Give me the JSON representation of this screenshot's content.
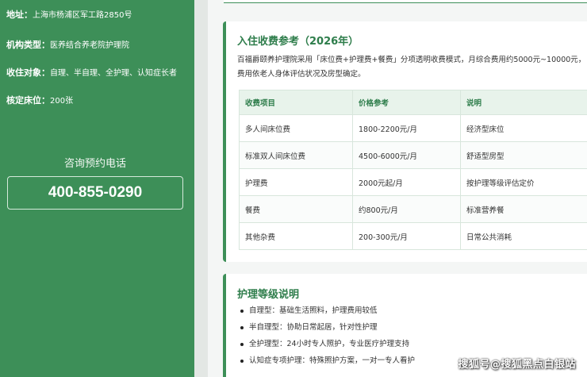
{
  "sidebar": {
    "address_label": "地址：",
    "address_value": "上海市杨浦区军工路2850号",
    "type_label": "机构类型：",
    "type_value": "医养结合养老院护理院",
    "target_label": "收住对象：",
    "target_value": "自理、半自理、全护理、认知症长者",
    "beds_label": "核定床位：",
    "beds_value": "200张",
    "consult_label": "咨询预约电话",
    "phone": "400-855-0290"
  },
  "fees": {
    "title": "入住收费参考（2026年）",
    "description": "百福爵颐养护理院采用「床位费+护理费+餐费」分项透明收费模式，月综合费用约5000元~10000元，费用依老人身体评估状况及房型确定。",
    "headers": [
      "收费项目",
      "价格参考",
      "说明"
    ],
    "rows": [
      [
        "多人间床位费",
        "1800-2200元/月",
        "经济型床位"
      ],
      [
        "标准双人间床位费",
        "4500-6000元/月",
        "舒适型房型"
      ],
      [
        "护理费",
        "2000元起/月",
        "按护理等级评估定价"
      ],
      [
        "餐费",
        "约800元/月",
        "标准营养餐"
      ],
      [
        "其他杂费",
        "200-300元/月",
        "日常公共消耗"
      ]
    ]
  },
  "care_levels": {
    "title": "护理等级说明",
    "items": [
      "自理型：基础生活照料，护理费用较低",
      "半自理型：协助日常起居，针对性护理",
      "全护理型：24小时专人照护，专业医疗护理支持",
      "认知症专项护理：特殊照护方案，一对一专人看护"
    ]
  },
  "watermark": "搜狐号@搜狐黑点白银站",
  "colors": {
    "accent": "#3d8f58",
    "title": "#2e7d4b"
  }
}
